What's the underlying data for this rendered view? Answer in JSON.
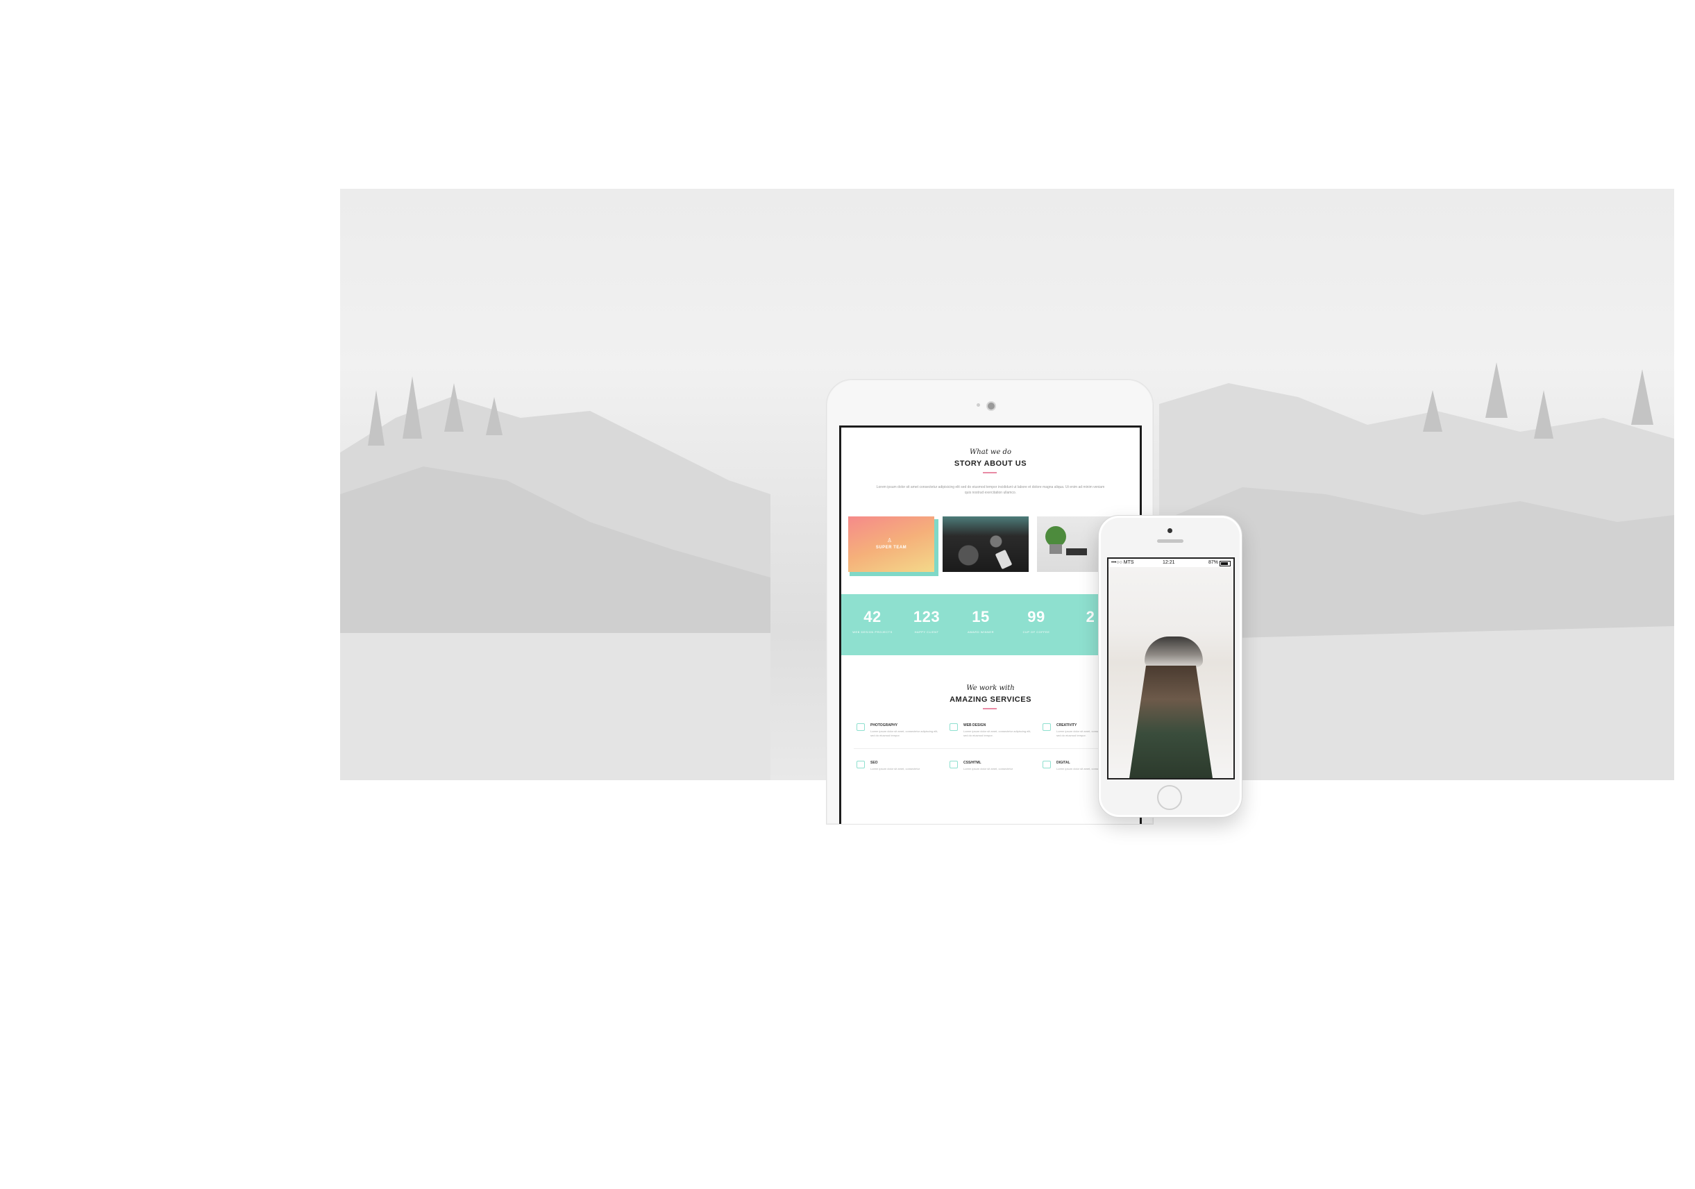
{
  "tablet": {
    "script_title": "What we do",
    "heading": "STORY ABOUT US",
    "lorem": "Lorem ipsum dolor sit amet consectetur adipisicing elit sed do eiusmod tempor incididunt ut labore et dolore magna aliqua. Ut enim ad minim veniam quis nostrud exercitation ullamco.",
    "team_tile_label": "SUPER TEAM",
    "stats": [
      {
        "value": "42",
        "label": "WEB DESIGN PROJECTS"
      },
      {
        "value": "123",
        "label": "HAPPY CLIENT"
      },
      {
        "value": "15",
        "label": "AWARD WINNER"
      },
      {
        "value": "99",
        "label": "CUP OF COFFEE"
      },
      {
        "value": "2",
        "label": ""
      }
    ],
    "services_script": "We work with",
    "services_heading": "AMAZING SERVICES",
    "services": [
      {
        "title": "PHOTOGRAPHY",
        "text": "Lorem ipsum dolor sit amet, consectetur adipiscing elit, sed do eiusmod tempor."
      },
      {
        "title": "WEB DESIGN",
        "text": "Lorem ipsum dolor sit amet, consectetur adipiscing elit, sed do eiusmod tempor."
      },
      {
        "title": "CREATIVITY",
        "text": "Lorem ipsum dolor sit amet, consectetur adipiscing elit, sed do eiusmod tempor."
      },
      {
        "title": "SEO",
        "text": "Lorem ipsum dolor sit amet, consectetur"
      },
      {
        "title": "CSS/HTML",
        "text": "Lorem ipsum dolor sit amet, consectetur"
      },
      {
        "title": "DIGITAL",
        "text": "Lorem ipsum dolor sit amet, consectetur"
      }
    ]
  },
  "phone": {
    "carrier": "•••○○ MTS",
    "time": "12:21",
    "battery": "87%"
  },
  "colors": {
    "accent": "#8ee0cf",
    "pink": "#e88aa4"
  }
}
